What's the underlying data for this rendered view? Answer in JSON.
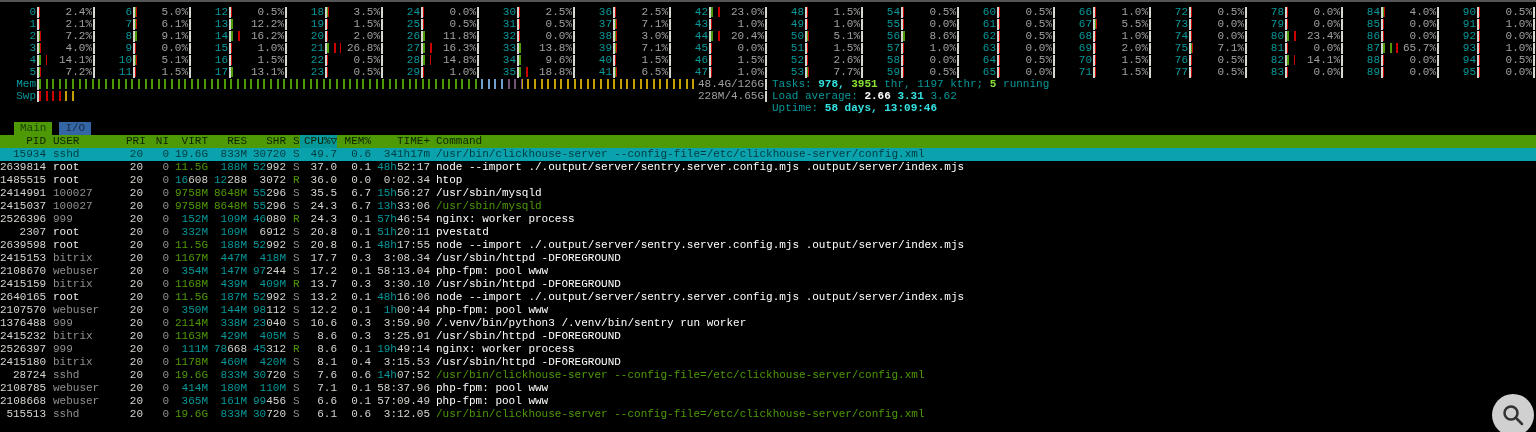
{
  "cpus": [
    {
      "label": "0",
      "level": 0.024,
      "reading": "2.4%"
    },
    {
      "label": "6",
      "level": 0.05,
      "reading": "5.0%"
    },
    {
      "label": "12",
      "level": 0.005,
      "reading": "0.5%"
    },
    {
      "label": "18",
      "level": 0.035,
      "reading": "3.5%"
    },
    {
      "label": "24",
      "level": 0.0,
      "reading": "0.0%"
    },
    {
      "label": "30",
      "level": 0.025,
      "reading": "2.5%"
    },
    {
      "label": "36",
      "level": 0.025,
      "reading": "2.5%"
    },
    {
      "label": "42",
      "level": 0.23,
      "reading": "23.0%"
    },
    {
      "label": "48",
      "level": 0.015,
      "reading": "1.5%"
    },
    {
      "label": "54",
      "level": 0.005,
      "reading": "0.5%"
    },
    {
      "label": "60",
      "level": 0.005,
      "reading": "0.5%"
    },
    {
      "label": "66",
      "level": 0.01,
      "reading": "1.0%"
    },
    {
      "label": "72",
      "level": 0.005,
      "reading": "0.5%"
    },
    {
      "label": "78",
      "level": 0.0,
      "reading": "0.0%"
    },
    {
      "label": "84",
      "level": 0.04,
      "reading": "4.0%"
    },
    {
      "label": "90",
      "level": 0.005,
      "reading": "0.5%"
    },
    {
      "label": "1",
      "level": 0.021,
      "reading": "2.1%"
    },
    {
      "label": "7",
      "level": 0.061,
      "reading": "6.1%"
    },
    {
      "label": "13",
      "level": 0.122,
      "reading": "12.2%"
    },
    {
      "label": "19",
      "level": 0.015,
      "reading": "1.5%"
    },
    {
      "label": "25",
      "level": 0.005,
      "reading": "0.5%"
    },
    {
      "label": "31",
      "level": 0.005,
      "reading": "0.5%"
    },
    {
      "label": "37",
      "level": 0.071,
      "reading": "7.1%"
    },
    {
      "label": "43",
      "level": 0.01,
      "reading": "1.0%"
    },
    {
      "label": "49",
      "level": 0.01,
      "reading": "1.0%"
    },
    {
      "label": "55",
      "level": 0.0,
      "reading": "0.0%"
    },
    {
      "label": "61",
      "level": 0.005,
      "reading": "0.5%"
    },
    {
      "label": "67",
      "level": 0.055,
      "reading": "5.5%"
    },
    {
      "label": "73",
      "level": 0.0,
      "reading": "0.0%"
    },
    {
      "label": "79",
      "level": 0.0,
      "reading": "0.0%"
    },
    {
      "label": "85",
      "level": 0.0,
      "reading": "0.0%"
    },
    {
      "label": "91",
      "level": 0.01,
      "reading": "1.0%"
    },
    {
      "label": "2",
      "level": 0.072,
      "reading": "7.2%"
    },
    {
      "label": "8",
      "level": 0.091,
      "reading": "9.1%"
    },
    {
      "label": "14",
      "level": 0.162,
      "reading": "16.2%"
    },
    {
      "label": "20",
      "level": 0.02,
      "reading": "2.0%"
    },
    {
      "label": "26",
      "level": 0.118,
      "reading": "11.8%"
    },
    {
      "label": "32",
      "level": 0.0,
      "reading": "0.0%"
    },
    {
      "label": "38",
      "level": 0.03,
      "reading": "3.0%"
    },
    {
      "label": "44",
      "level": 0.204,
      "reading": "20.4%"
    },
    {
      "label": "50",
      "level": 0.051,
      "reading": "5.1%"
    },
    {
      "label": "56",
      "level": 0.086,
      "reading": "8.6%"
    },
    {
      "label": "62",
      "level": 0.005,
      "reading": "0.5%"
    },
    {
      "label": "68",
      "level": 0.01,
      "reading": "1.0%"
    },
    {
      "label": "74",
      "level": 0.0,
      "reading": "0.0%"
    },
    {
      "label": "80",
      "level": 0.234,
      "reading": "23.4%"
    },
    {
      "label": "86",
      "level": 0.0,
      "reading": "0.0%"
    },
    {
      "label": "92",
      "level": 0.0,
      "reading": "0.0%"
    },
    {
      "label": "3",
      "level": 0.04,
      "reading": "4.0%"
    },
    {
      "label": "9",
      "level": 0.0,
      "reading": "0.0%"
    },
    {
      "label": "15",
      "level": 0.01,
      "reading": "1.0%"
    },
    {
      "label": "21",
      "level": 0.268,
      "reading": "26.8%"
    },
    {
      "label": "27",
      "level": 0.163,
      "reading": "16.3%"
    },
    {
      "label": "33",
      "level": 0.138,
      "reading": "13.8%"
    },
    {
      "label": "39",
      "level": 0.071,
      "reading": "7.1%"
    },
    {
      "label": "45",
      "level": 0.0,
      "reading": "0.0%"
    },
    {
      "label": "51",
      "level": 0.015,
      "reading": "1.5%"
    },
    {
      "label": "57",
      "level": 0.01,
      "reading": "1.0%"
    },
    {
      "label": "63",
      "level": 0.0,
      "reading": "0.0%"
    },
    {
      "label": "69",
      "level": 0.02,
      "reading": "2.0%"
    },
    {
      "label": "75",
      "level": 0.071,
      "reading": "7.1%"
    },
    {
      "label": "81",
      "level": 0.0,
      "reading": "0.0%"
    },
    {
      "label": "87",
      "level": 0.657,
      "reading": "65.7%"
    },
    {
      "label": "93",
      "level": 0.01,
      "reading": "1.0%"
    },
    {
      "label": "4",
      "level": 0.141,
      "reading": "14.1%"
    },
    {
      "label": "10",
      "level": 0.051,
      "reading": "5.1%"
    },
    {
      "label": "16",
      "level": 0.015,
      "reading": "1.5%"
    },
    {
      "label": "22",
      "level": 0.005,
      "reading": "0.5%"
    },
    {
      "label": "28",
      "level": 0.148,
      "reading": "14.8%"
    },
    {
      "label": "34",
      "level": 0.096,
      "reading": "9.6%"
    },
    {
      "label": "40",
      "level": 0.015,
      "reading": "1.5%"
    },
    {
      "label": "46",
      "level": 0.015,
      "reading": "1.5%"
    },
    {
      "label": "52",
      "level": 0.026,
      "reading": "2.6%"
    },
    {
      "label": "58",
      "level": 0.0,
      "reading": "0.0%"
    },
    {
      "label": "64",
      "level": 0.005,
      "reading": "0.5%"
    },
    {
      "label": "70",
      "level": 0.015,
      "reading": "1.5%"
    },
    {
      "label": "76",
      "level": 0.005,
      "reading": "0.5%"
    },
    {
      "label": "82",
      "level": 0.141,
      "reading": "14.1%"
    },
    {
      "label": "88",
      "level": 0.0,
      "reading": "0.0%"
    },
    {
      "label": "94",
      "level": 0.005,
      "reading": "0.5%"
    },
    {
      "label": "5",
      "level": 0.072,
      "reading": "7.2%"
    },
    {
      "label": "11",
      "level": 0.015,
      "reading": "1.5%"
    },
    {
      "label": "17",
      "level": 0.131,
      "reading": "13.1%"
    },
    {
      "label": "23",
      "level": 0.005,
      "reading": "0.5%"
    },
    {
      "label": "29",
      "level": 0.01,
      "reading": "1.0%"
    },
    {
      "label": "35",
      "level": 0.188,
      "reading": "18.8%"
    },
    {
      "label": "41",
      "level": 0.065,
      "reading": "6.5%"
    },
    {
      "label": "47",
      "level": 0.01,
      "reading": "1.0%"
    },
    {
      "label": "53",
      "level": 0.077,
      "reading": "7.7%"
    },
    {
      "label": "59",
      "level": 0.005,
      "reading": "0.5%"
    },
    {
      "label": "65",
      "level": 0.0,
      "reading": "0.0%"
    },
    {
      "label": "71",
      "level": 0.015,
      "reading": "1.5%"
    },
    {
      "label": "77",
      "level": 0.005,
      "reading": "0.5%"
    },
    {
      "label": "83",
      "level": 0.0,
      "reading": "0.0%"
    },
    {
      "label": "89",
      "level": 0.0,
      "reading": "0.0%"
    },
    {
      "label": "95",
      "level": 0.0,
      "reading": "0.0%"
    }
  ],
  "memory": [
    {
      "label": "Mem",
      "level": 0.95,
      "reading": "48.4G/126G",
      "kind": "mem"
    },
    {
      "label": "Swp",
      "level": 0.05,
      "reading": "228M/4.65G",
      "kind": "swap"
    }
  ],
  "info": [
    [
      {
        "text": "Tasks:",
        "kind": "label"
      },
      {
        "text": "978,",
        "kind": "value"
      },
      {
        "text": "3951",
        "kind": "green"
      },
      {
        "text": "thr, 1197 kthr;",
        "kind": "label"
      },
      {
        "text": "5",
        "kind": "green"
      },
      {
        "text": "running",
        "kind": "label"
      }
    ],
    [
      {
        "text": "Load average:",
        "kind": "label"
      },
      {
        "text": "2.66",
        "kind": "white"
      },
      {
        "text": "3.31",
        "kind": "value"
      },
      {
        "text": "3.62",
        "kind": "label"
      }
    ],
    [
      {
        "text": "Uptime:",
        "kind": "label"
      },
      {
        "text": "58 days, 13:09:46",
        "kind": "value"
      }
    ]
  ],
  "tabs": [
    {
      "label": "Main",
      "selected": true
    },
    {
      "label": "I/O",
      "selected": false
    }
  ],
  "columns": [
    {
      "label": "PID",
      "sorted": false
    },
    {
      "label": "USER",
      "sorted": false
    },
    {
      "label": "PRI",
      "sorted": false
    },
    {
      "label": "NI",
      "sorted": false
    },
    {
      "label": "VIRT",
      "sorted": false
    },
    {
      "label": "RES",
      "sorted": false
    },
    {
      "label": "SHR",
      "sorted": false
    },
    {
      "label": "S",
      "sorted": false
    },
    {
      "label": "CPU%",
      "sorted": true
    },
    {
      "label": "MEM%",
      "sorted": false
    },
    {
      "label": "TIME+",
      "sorted": false
    },
    {
      "label": "Command",
      "sorted": false
    }
  ],
  "sort_indicator": "▽",
  "rows": [
    {
      "cells": [
        "15934",
        "sshd",
        "20",
        "0",
        "19.6G",
        "833M",
        "30720",
        "S",
        "49.7",
        "0.6",
        "341h17m",
        "/usr/bin/clickhouse-server --config-file=/etc/clickhouse-server/config.xml"
      ],
      "selected": true,
      "running": false,
      "thread": false,
      "own_user": false
    },
    {
      "cells": [
        "2639814",
        "root",
        "20",
        "0",
        "11.5G",
        "188M",
        "52992",
        "S",
        "37.0",
        "0.1",
        "48h52:17",
        "node --import ./.output/server/sentry.server.config.mjs .output/server/index.mjs"
      ],
      "selected": false,
      "running": false,
      "thread": false,
      "own_user": true
    },
    {
      "cells": [
        "1485515",
        "root",
        "20",
        "0",
        "16608",
        "12288",
        "3072",
        "R",
        "36.0",
        "0.0",
        "0:02.34",
        "htop"
      ],
      "selected": false,
      "running": true,
      "thread": false,
      "own_user": true
    },
    {
      "cells": [
        "2414991",
        "100027",
        "20",
        "0",
        "9758M",
        "8648M",
        "55296",
        "S",
        "35.5",
        "6.7",
        "15h56:27",
        "/usr/sbin/mysqld"
      ],
      "selected": false,
      "running": false,
      "thread": false,
      "own_user": false
    },
    {
      "cells": [
        "2415037",
        "100027",
        "20",
        "0",
        "9758M",
        "8648M",
        "55296",
        "S",
        "24.3",
        "6.7",
        "13h33:06",
        "/usr/sbin/mysqld"
      ],
      "selected": false,
      "running": false,
      "thread": true,
      "own_user": false
    },
    {
      "cells": [
        "2526396",
        "999",
        "20",
        "0",
        "152M",
        "109M",
        "46080",
        "R",
        "24.3",
        "0.1",
        "57h46:54",
        "nginx: worker process"
      ],
      "selected": false,
      "running": true,
      "thread": false,
      "own_user": false
    },
    {
      "cells": [
        "2307",
        "root",
        "20",
        "0",
        "332M",
        "109M",
        "6912",
        "S",
        "20.8",
        "0.1",
        "51h20:11",
        "pvestatd"
      ],
      "selected": false,
      "running": false,
      "thread": false,
      "own_user": true
    },
    {
      "cells": [
        "2639598",
        "root",
        "20",
        "0",
        "11.5G",
        "188M",
        "52992",
        "S",
        "20.8",
        "0.1",
        "48h17:55",
        "node --import ./.output/server/sentry.server.config.mjs .output/server/index.mjs"
      ],
      "selected": false,
      "running": false,
      "thread": false,
      "own_user": true
    },
    {
      "cells": [
        "2415153",
        "bitrix",
        "20",
        "0",
        "1167M",
        "447M",
        "418M",
        "S",
        "17.7",
        "0.3",
        "3:08.34",
        "/usr/sbin/httpd -DFOREGROUND"
      ],
      "selected": false,
      "running": false,
      "thread": false,
      "own_user": false
    },
    {
      "cells": [
        "2108670",
        "webuser",
        "20",
        "0",
        "354M",
        "147M",
        "97244",
        "S",
        "17.2",
        "0.1",
        "58:13.04",
        "php-fpm: pool www"
      ],
      "selected": false,
      "running": false,
      "thread": false,
      "own_user": false
    },
    {
      "cells": [
        "2415159",
        "bitrix",
        "20",
        "0",
        "1168M",
        "439M",
        "409M",
        "R",
        "13.7",
        "0.3",
        "3:30.10",
        "/usr/sbin/httpd -DFOREGROUND"
      ],
      "selected": false,
      "running": true,
      "thread": false,
      "own_user": false
    },
    {
      "cells": [
        "2640165",
        "root",
        "20",
        "0",
        "11.5G",
        "187M",
        "52992",
        "S",
        "13.2",
        "0.1",
        "48h16:06",
        "node --import ./.output/server/sentry.server.config.mjs .output/server/index.mjs"
      ],
      "selected": false,
      "running": false,
      "thread": false,
      "own_user": true
    },
    {
      "cells": [
        "2107570",
        "webuser",
        "20",
        "0",
        "350M",
        "144M",
        "98112",
        "S",
        "12.2",
        "0.1",
        "1h00:44",
        "php-fpm: pool www"
      ],
      "selected": false,
      "running": false,
      "thread": false,
      "own_user": false
    },
    {
      "cells": [
        "1376488",
        "999",
        "20",
        "0",
        "2114M",
        "338M",
        "23040",
        "S",
        "10.6",
        "0.3",
        "3:59.90",
        "/.venv/bin/python3 /.venv/bin/sentry run worker"
      ],
      "selected": false,
      "running": false,
      "thread": false,
      "own_user": false
    },
    {
      "cells": [
        "2415232",
        "bitrix",
        "20",
        "0",
        "1163M",
        "429M",
        "405M",
        "S",
        "8.6",
        "0.3",
        "3:25.91",
        "/usr/sbin/httpd -DFOREGROUND"
      ],
      "selected": false,
      "running": false,
      "thread": false,
      "own_user": false
    },
    {
      "cells": [
        "2526397",
        "999",
        "20",
        "0",
        "111M",
        "78668",
        "45312",
        "R",
        "8.6",
        "0.1",
        "19h49:14",
        "nginx: worker process"
      ],
      "selected": false,
      "running": true,
      "thread": false,
      "own_user": false
    },
    {
      "cells": [
        "2415180",
        "bitrix",
        "20",
        "0",
        "1178M",
        "460M",
        "420M",
        "S",
        "8.1",
        "0.4",
        "3:15.53",
        "/usr/sbin/httpd -DFOREGROUND"
      ],
      "selected": false,
      "running": false,
      "thread": false,
      "own_user": false
    },
    {
      "cells": [
        "28724",
        "sshd",
        "20",
        "0",
        "19.6G",
        "833M",
        "30720",
        "S",
        "7.6",
        "0.6",
        "14h07:52",
        "/usr/bin/clickhouse-server --config-file=/etc/clickhouse-server/config.xml"
      ],
      "selected": false,
      "running": false,
      "thread": true,
      "own_user": false
    },
    {
      "cells": [
        "2108785",
        "webuser",
        "20",
        "0",
        "414M",
        "180M",
        "110M",
        "S",
        "7.1",
        "0.1",
        "58:37.96",
        "php-fpm: pool www"
      ],
      "selected": false,
      "running": false,
      "thread": false,
      "own_user": false
    },
    {
      "cells": [
        "2108668",
        "webuser",
        "20",
        "0",
        "365M",
        "161M",
        "99456",
        "S",
        "6.6",
        "0.1",
        "57:09.49",
        "php-fpm: pool www"
      ],
      "selected": false,
      "running": false,
      "thread": false,
      "own_user": false
    },
    {
      "cells": [
        "515513",
        "sshd",
        "20",
        "0",
        "19.6G",
        "833M",
        "30720",
        "S",
        "6.1",
        "0.6",
        "3:12.05",
        "/usr/bin/clickhouse-server --config-file=/etc/clickhouse-server/config.xml"
      ],
      "selected": false,
      "running": false,
      "thread": true,
      "own_user": false
    }
  ]
}
